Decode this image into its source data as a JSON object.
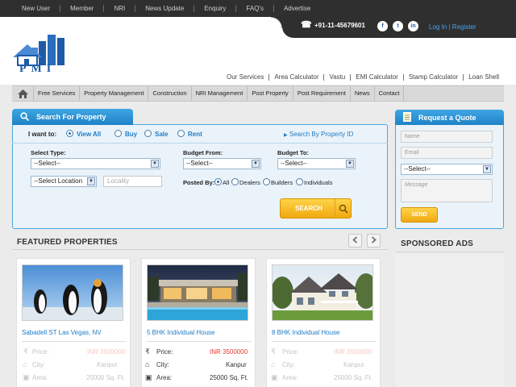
{
  "topnav": [
    "New User",
    "Member",
    "NRI",
    "News Update",
    "Enquiry",
    "FAQ's",
    "Advertise"
  ],
  "contact": {
    "phone": "+91-11-45679601",
    "login": "Log In",
    "separator": "|",
    "register": "Register"
  },
  "social": [
    {
      "icon": "facebook-icon",
      "glyph": "f"
    },
    {
      "icon": "twitter-icon",
      "glyph": "t"
    },
    {
      "icon": "linkedin-icon",
      "glyph": "in"
    }
  ],
  "logo": {
    "text": "PMI"
  },
  "sublinks": [
    "Our Services",
    "Area Calculator",
    "Vastu",
    "EMI Calculator",
    "Stamp Calculator",
    "Loan Shell"
  ],
  "mainnav": [
    "Free Services",
    "Property Management",
    "Construction",
    "NRI Management",
    "Post Property",
    "Post Requirement",
    "News",
    "Contact"
  ],
  "search": {
    "tab_label": "Search For Property",
    "want_label": "I want to:",
    "want_options": [
      "View All",
      "Buy",
      "Sale",
      "Rent"
    ],
    "search_by_id": "Search By Property ID",
    "select_type_label": "Select Type:",
    "select_type_value": "--Select--",
    "budget_from_label": "Budget From:",
    "budget_from_value": "--Select--",
    "budget_to_label": "Budget To:",
    "budget_to_value": "--Select--",
    "location_value": "--Select Location",
    "locality_placeholder": "Locality",
    "posted_by_label": "Posted By:",
    "posted_by_options": [
      "All",
      "Dealers",
      "Builders",
      "Individuals"
    ],
    "search_button": "SEARCH"
  },
  "quote": {
    "tab_label": "Request a Quote",
    "name_placeholder": "Name",
    "email_placeholder": "Email",
    "select_value": "--Select--",
    "message_placeholder": "Message",
    "send_button": "SEND"
  },
  "featured": {
    "title": "FEATURED PROPERTIES",
    "cards": [
      {
        "title": "Sabadell ST Las Vegas, NV",
        "image": "penguins",
        "price_label": "Price:",
        "price": "INR 3500000",
        "city_label": "City:",
        "city": "Kanpur",
        "area_label": "Area:",
        "area": "25000 Sq. Ft."
      },
      {
        "title": "5 BHK Individual House",
        "image": "modern-house",
        "price_label": "Price:",
        "price": "INR 3500000",
        "city_label": "City:",
        "city": "Kanpur",
        "area_label": "Area:",
        "area": "25000 Sq. Ft."
      },
      {
        "title": "8 BHK Individual House",
        "image": "victorian-house",
        "price_label": "Price:",
        "price": "INR 3500000",
        "city_label": "City:",
        "city": "Kanpur",
        "area_label": "Area:",
        "area": "25000 Sq. Ft."
      }
    ]
  },
  "sponsored": {
    "title": "SPONSORED ADS"
  },
  "colors": {
    "accent_blue": "#1f82c7",
    "button_yellow": "#f0a90f",
    "price_red": "#e03b2b",
    "topbar": "#2f2f2f"
  }
}
